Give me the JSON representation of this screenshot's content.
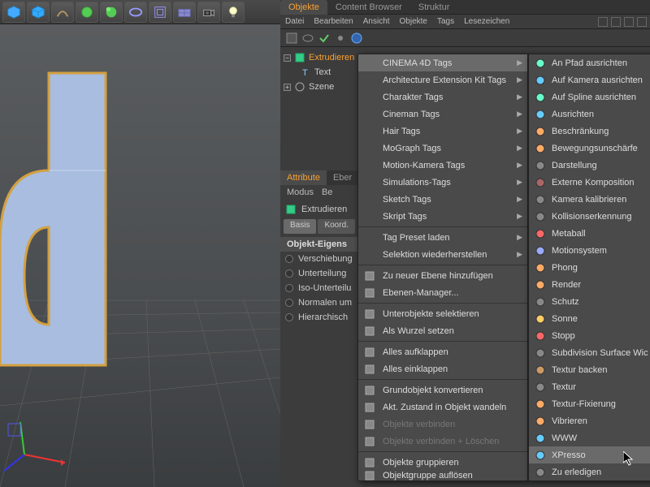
{
  "toolbar": {
    "icons": [
      "cube",
      "cube2",
      "brush",
      "primitive",
      "primitive2",
      "array",
      "deform",
      "grid",
      "camera",
      "light"
    ]
  },
  "panel_tabs": {
    "objects": "Objekte",
    "content": "Content Browser",
    "structure": "Struktur"
  },
  "obj_menu": {
    "file": "Datei",
    "edit": "Bearbeiten",
    "view": "Ansicht",
    "objects": "Objekte",
    "tags": "Tags",
    "bookmarks": "Lesezeichen"
  },
  "tree": {
    "extrude": "Extrudieren",
    "text": "Text",
    "scene": "Szene"
  },
  "attr": {
    "tab_attribute": "Attribute",
    "tab_layers": "Eber",
    "menu_mode": "Modus",
    "menu_edit": "Be",
    "head": "Extrudieren",
    "sub_basis": "Basis",
    "sub_koord": "Koord.",
    "section": "Objekt-Eigens",
    "prop1": "Verschiebung",
    "prop2": "Unterteilung",
    "prop3": "Iso-Unterteilu",
    "prop4": "Normalen um",
    "prop5": "Hierarchisch"
  },
  "context_menu": [
    {
      "label": "CINEMA 4D Tags",
      "arrow": true,
      "highlight": true
    },
    {
      "label": "Architecture Extension Kit Tags",
      "arrow": true
    },
    {
      "label": "Charakter Tags",
      "arrow": true
    },
    {
      "label": "Cineman Tags",
      "arrow": true
    },
    {
      "label": "Hair Tags",
      "arrow": true
    },
    {
      "label": "MoGraph Tags",
      "arrow": true
    },
    {
      "label": "Motion-Kamera Tags",
      "arrow": true
    },
    {
      "label": "Simulations-Tags",
      "arrow": true
    },
    {
      "label": "Sketch Tags",
      "arrow": true
    },
    {
      "label": "Skript Tags",
      "arrow": true
    },
    {
      "sep": true
    },
    {
      "label": "Tag Preset laden",
      "arrow": true
    },
    {
      "label": "Selektion wiederherstellen",
      "arrow": true
    },
    {
      "sep": true
    },
    {
      "label": "Zu neuer Ebene hinzufügen",
      "icon": "layer-add"
    },
    {
      "label": "Ebenen-Manager...",
      "icon": "layers"
    },
    {
      "sep": true
    },
    {
      "label": "Unterobjekte selektieren",
      "icon": "select-child"
    },
    {
      "label": "Als Wurzel setzen",
      "icon": "root"
    },
    {
      "sep": true
    },
    {
      "label": "Alles aufklappen",
      "icon": "expand"
    },
    {
      "label": "Alles einklappen",
      "icon": "collapse"
    },
    {
      "sep": true
    },
    {
      "label": "Grundobjekt konvertieren",
      "icon": "convert"
    },
    {
      "label": "Akt. Zustand in Objekt wandeln",
      "icon": "state"
    },
    {
      "label": "Objekte verbinden",
      "icon": "connect",
      "disabled": true
    },
    {
      "label": "Objekte verbinden + Löschen",
      "icon": "connect-del",
      "disabled": true
    },
    {
      "sep": true
    },
    {
      "label": "Objekte gruppieren",
      "icon": "group"
    },
    {
      "label": "Objektgruppe auflösen",
      "icon": "ungroup",
      "cut": true
    }
  ],
  "submenu": [
    {
      "label": "An Pfad ausrichten",
      "color": "#6fc"
    },
    {
      "label": "Auf Kamera ausrichten",
      "color": "#6cf"
    },
    {
      "label": "Auf Spline ausrichten",
      "color": "#6fc"
    },
    {
      "label": "Ausrichten",
      "color": "#6cf"
    },
    {
      "label": "Beschränkung",
      "color": "#fa6"
    },
    {
      "label": "Bewegungsunschärfe",
      "color": "#fa6"
    },
    {
      "label": "Darstellung",
      "color": "#888"
    },
    {
      "label": "Externe Komposition",
      "color": "#a66"
    },
    {
      "label": "Kamera kalibrieren",
      "color": "#888"
    },
    {
      "label": "Kollisionserkennung",
      "color": "#888"
    },
    {
      "label": "Metaball",
      "color": "#f66"
    },
    {
      "label": "Motionsystem",
      "color": "#9af"
    },
    {
      "label": "Phong",
      "color": "#fa6"
    },
    {
      "label": "Render",
      "color": "#fa6"
    },
    {
      "label": "Schutz",
      "color": "#888"
    },
    {
      "label": "Sonne",
      "color": "#fc6"
    },
    {
      "label": "Stopp",
      "color": "#f66"
    },
    {
      "label": "Subdivision Surface Wic",
      "color": "#888"
    },
    {
      "label": "Textur backen",
      "color": "#c96"
    },
    {
      "label": "Textur",
      "color": "#888"
    },
    {
      "label": "Textur-Fixierung",
      "color": "#fa6"
    },
    {
      "label": "Vibrieren",
      "color": "#fa6"
    },
    {
      "label": "WWW",
      "color": "#6cf"
    },
    {
      "label": "XPresso",
      "color": "#6cf",
      "highlight": true
    },
    {
      "label": "Zu erledigen",
      "color": "#888"
    }
  ]
}
